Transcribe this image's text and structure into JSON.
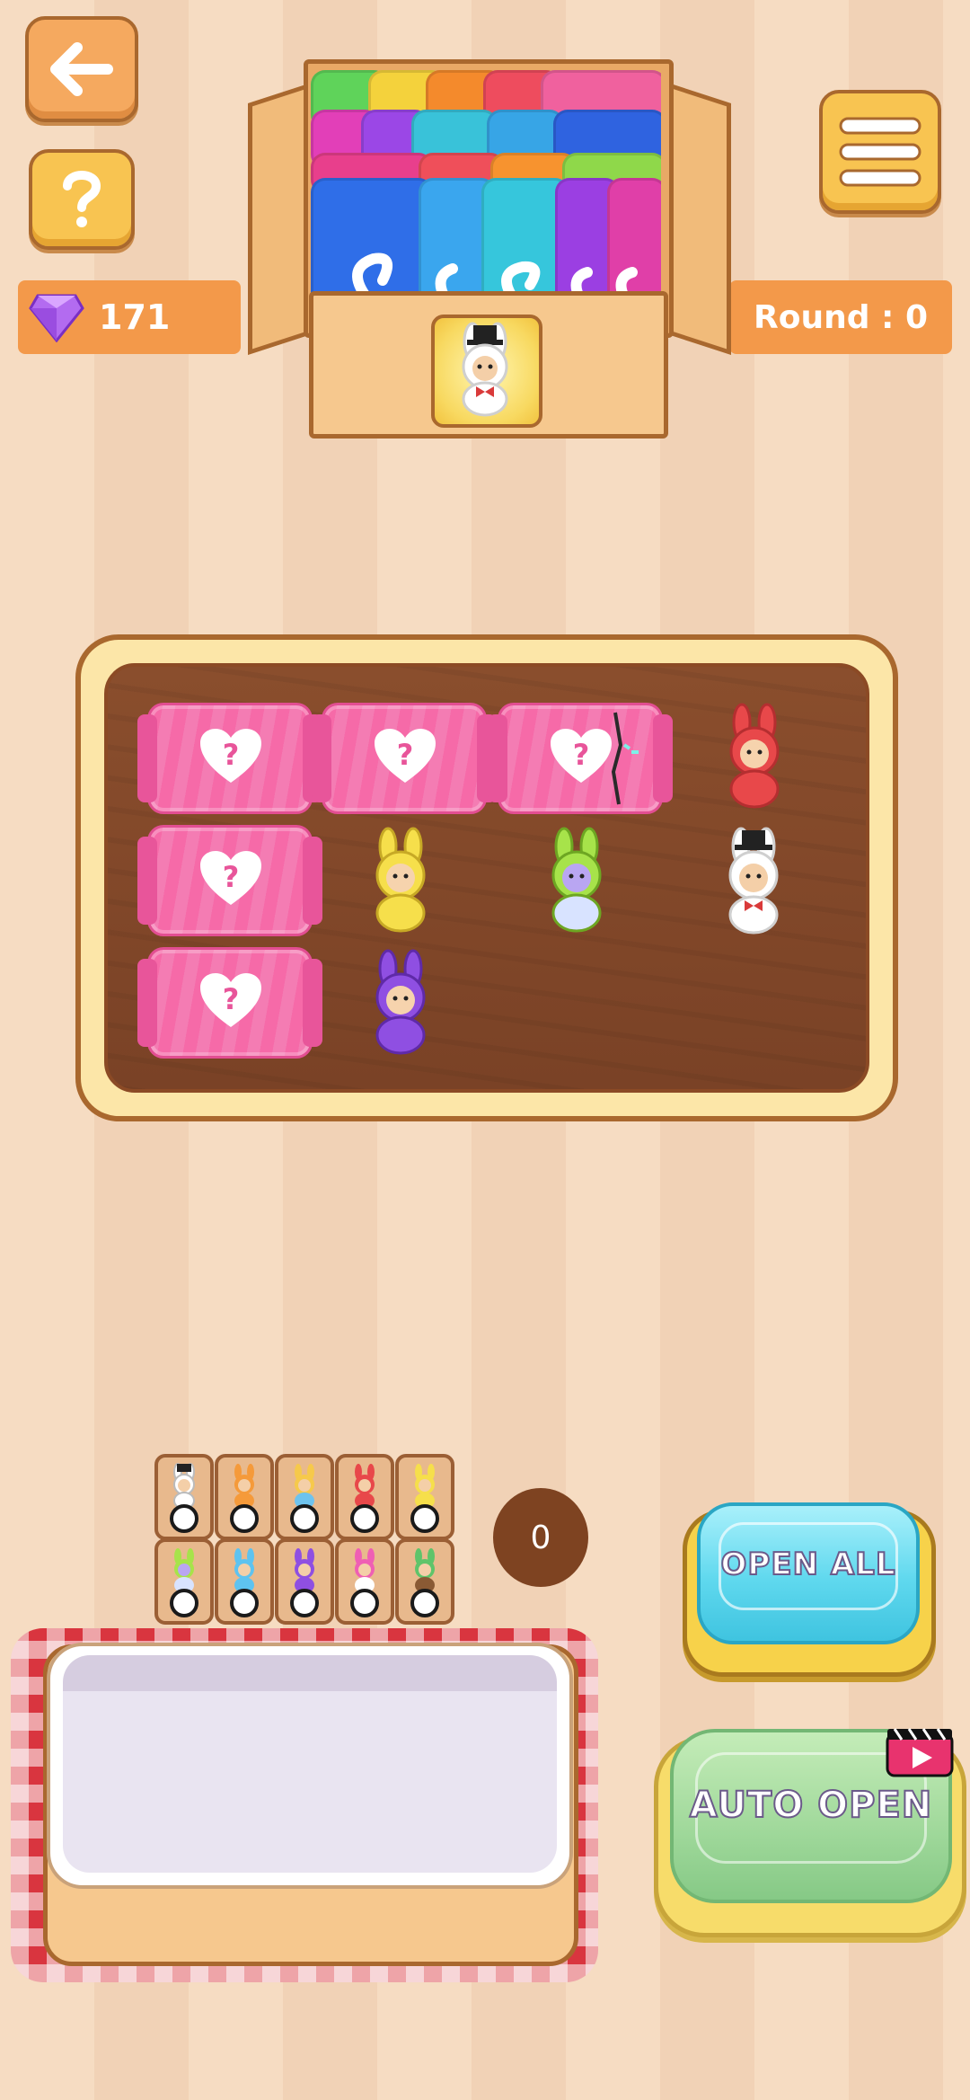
{
  "hud": {
    "gems": "171",
    "round": "Round : 0"
  },
  "icons": {
    "back": "arrow-left-icon",
    "help": "question-mark-icon",
    "menu": "hamburger-menu-icon",
    "gem": "diamond-gem-icon",
    "video": "video-ad-icon"
  },
  "colors": {
    "accent_orange": "#f3994a",
    "candy_pink": "#f66aa8",
    "wood": "#7a4226",
    "open_all_cyan": "#5fd8ee",
    "auto_open_green": "#9fd89a"
  },
  "board": {
    "candies": [
      "candy-1",
      "candy-2",
      "candy-3",
      "candy-4",
      "candy-5"
    ],
    "toys": [
      "red",
      "yellow",
      "lime",
      "white",
      "purple"
    ]
  },
  "collection": {
    "toys": [
      "white",
      "orange",
      "yellow",
      "red",
      "yellow",
      "lime",
      "sky",
      "purple",
      "pink",
      "green"
    ]
  },
  "counter": "0",
  "buttons": {
    "open_all": "OPEN ALL",
    "auto_open": "AUTO OPEN"
  }
}
